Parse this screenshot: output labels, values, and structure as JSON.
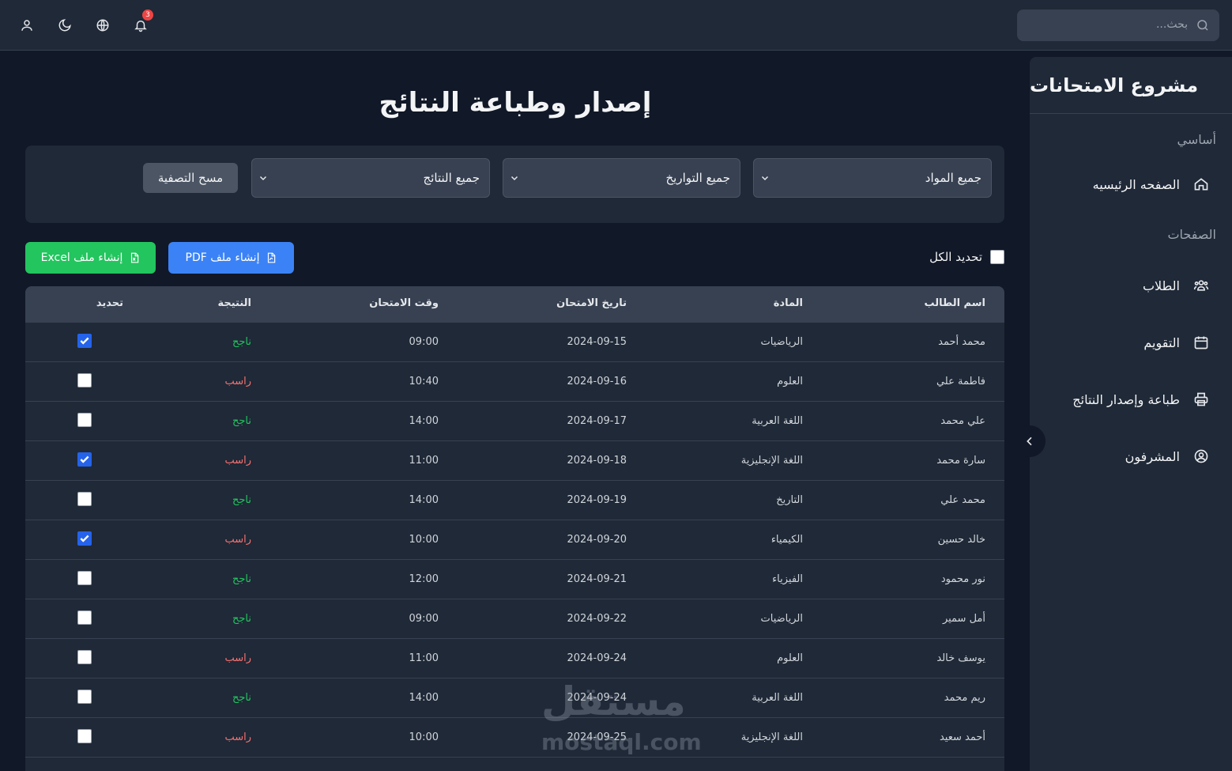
{
  "topbar": {
    "search_placeholder": "بحث...",
    "notification_count": "3"
  },
  "sidebar": {
    "title": "مشروع الامتحانات",
    "section_basic": "أساسي",
    "section_pages": "الصفحات",
    "items": [
      {
        "label": "الصفحه الرئيسيه",
        "icon": "home-icon"
      },
      {
        "label": "الطلاب",
        "icon": "users-icon"
      },
      {
        "label": "التقويم",
        "icon": "calendar-icon"
      },
      {
        "label": "طباعة وإصدار النتائج",
        "icon": "printer-icon"
      },
      {
        "label": "المشرفون",
        "icon": "user-circle-icon"
      }
    ]
  },
  "main": {
    "title": "إصدار وطباعة النتائج",
    "filters": {
      "subjects": "جميع المواد",
      "dates": "جميع التواريخ",
      "results": "جميع النتائج",
      "clear": "مسح التصفية"
    },
    "select_all": "تحديد الكل",
    "pdf_button": "إنشاء ملف PDF",
    "excel_button": "إنشاء ملف Excel"
  },
  "table": {
    "headers": {
      "name": "اسم الطالب",
      "subject": "المادة",
      "date": "تاريخ الامتحان",
      "time": "وقت الامتحان",
      "result": "النتيجة",
      "select": "تحديد"
    },
    "rows": [
      {
        "name": "محمد أحمد",
        "subject": "الرياضيات",
        "date": "2024-09-15",
        "time": "09:00",
        "result": "ناجح",
        "checked": true
      },
      {
        "name": "فاطمة علي",
        "subject": "العلوم",
        "date": "2024-09-16",
        "time": "10:40",
        "result": "راسب",
        "checked": false
      },
      {
        "name": "علي محمد",
        "subject": "اللغة العربية",
        "date": "2024-09-17",
        "time": "14:00",
        "result": "ناجح",
        "checked": false
      },
      {
        "name": "سارة محمد",
        "subject": "اللغة الإنجليزية",
        "date": "2024-09-18",
        "time": "11:00",
        "result": "راسب",
        "checked": true
      },
      {
        "name": "محمد علي",
        "subject": "التاريخ",
        "date": "2024-09-19",
        "time": "14:00",
        "result": "ناجح",
        "checked": false
      },
      {
        "name": "خالد حسين",
        "subject": "الكيمياء",
        "date": "2024-09-20",
        "time": "10:00",
        "result": "راسب",
        "checked": true
      },
      {
        "name": "نور محمود",
        "subject": "الفيزياء",
        "date": "2024-09-21",
        "time": "12:00",
        "result": "ناجح",
        "checked": false
      },
      {
        "name": "أمل سمير",
        "subject": "الرياضيات",
        "date": "2024-09-22",
        "time": "09:00",
        "result": "ناجح",
        "checked": false
      },
      {
        "name": "يوسف خالد",
        "subject": "العلوم",
        "date": "2024-09-24",
        "time": "11:00",
        "result": "راسب",
        "checked": false
      },
      {
        "name": "ريم محمد",
        "subject": "اللغة العربية",
        "date": "2024-09-24",
        "time": "14:00",
        "result": "ناجح",
        "checked": false
      },
      {
        "name": "أحمد سعيد",
        "subject": "اللغة الإنجليزية",
        "date": "2024-09-25",
        "time": "10:00",
        "result": "راسب",
        "checked": false
      }
    ]
  },
  "watermark": {
    "arabic": "مستقل",
    "latin": "mostaql.com"
  },
  "colors": {
    "pass": "#22c55e",
    "fail": "#f87171",
    "pdf": "#3b82f6",
    "excel": "#22c55e"
  }
}
